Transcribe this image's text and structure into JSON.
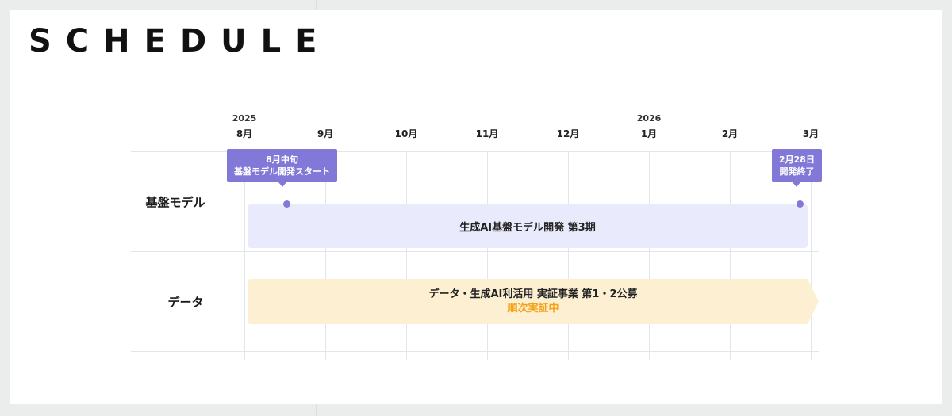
{
  "header": {
    "title": "SCHEDULE"
  },
  "timeline": {
    "years": [
      {
        "label": "2025",
        "month_index": 0
      },
      {
        "label": "2026",
        "month_index": 5
      }
    ],
    "months": [
      "8月",
      "9月",
      "10月",
      "11月",
      "12月",
      "1月",
      "2月",
      "3月"
    ]
  },
  "rows": [
    {
      "label": "基盤モデル"
    },
    {
      "label": "データ"
    }
  ],
  "bars": {
    "model": {
      "label": "生成AI基盤モデル開発 第3期",
      "color": "#e9eafb"
    },
    "data": {
      "line1": "データ・生成AI利活用 実証事業 第1・2公募",
      "line2": "順次実証中",
      "color": "#fdf0d2",
      "accent": "#f5a118"
    }
  },
  "milestones": {
    "start": {
      "line1": "8月中旬",
      "line2": "基盤モデル開発スタート"
    },
    "end": {
      "line1": "2月28日",
      "line2": "開発終了"
    },
    "color": "#8278d8"
  }
}
